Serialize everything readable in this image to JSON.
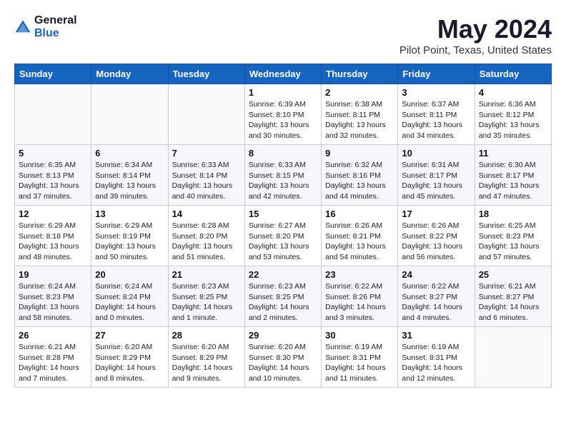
{
  "header": {
    "logo_general": "General",
    "logo_blue": "Blue",
    "month_title": "May 2024",
    "location": "Pilot Point, Texas, United States"
  },
  "days_of_week": [
    "Sunday",
    "Monday",
    "Tuesday",
    "Wednesday",
    "Thursday",
    "Friday",
    "Saturday"
  ],
  "weeks": [
    [
      {
        "day": "",
        "info": ""
      },
      {
        "day": "",
        "info": ""
      },
      {
        "day": "",
        "info": ""
      },
      {
        "day": "1",
        "info": "Sunrise: 6:39 AM\nSunset: 8:10 PM\nDaylight: 13 hours\nand 30 minutes."
      },
      {
        "day": "2",
        "info": "Sunrise: 6:38 AM\nSunset: 8:11 PM\nDaylight: 13 hours\nand 32 minutes."
      },
      {
        "day": "3",
        "info": "Sunrise: 6:37 AM\nSunset: 8:11 PM\nDaylight: 13 hours\nand 34 minutes."
      },
      {
        "day": "4",
        "info": "Sunrise: 6:36 AM\nSunset: 8:12 PM\nDaylight: 13 hours\nand 35 minutes."
      }
    ],
    [
      {
        "day": "5",
        "info": "Sunrise: 6:35 AM\nSunset: 8:13 PM\nDaylight: 13 hours\nand 37 minutes."
      },
      {
        "day": "6",
        "info": "Sunrise: 6:34 AM\nSunset: 8:14 PM\nDaylight: 13 hours\nand 39 minutes."
      },
      {
        "day": "7",
        "info": "Sunrise: 6:33 AM\nSunset: 8:14 PM\nDaylight: 13 hours\nand 40 minutes."
      },
      {
        "day": "8",
        "info": "Sunrise: 6:33 AM\nSunset: 8:15 PM\nDaylight: 13 hours\nand 42 minutes."
      },
      {
        "day": "9",
        "info": "Sunrise: 6:32 AM\nSunset: 8:16 PM\nDaylight: 13 hours\nand 44 minutes."
      },
      {
        "day": "10",
        "info": "Sunrise: 6:31 AM\nSunset: 8:17 PM\nDaylight: 13 hours\nand 45 minutes."
      },
      {
        "day": "11",
        "info": "Sunrise: 6:30 AM\nSunset: 8:17 PM\nDaylight: 13 hours\nand 47 minutes."
      }
    ],
    [
      {
        "day": "12",
        "info": "Sunrise: 6:29 AM\nSunset: 8:18 PM\nDaylight: 13 hours\nand 48 minutes."
      },
      {
        "day": "13",
        "info": "Sunrise: 6:29 AM\nSunset: 8:19 PM\nDaylight: 13 hours\nand 50 minutes."
      },
      {
        "day": "14",
        "info": "Sunrise: 6:28 AM\nSunset: 8:20 PM\nDaylight: 13 hours\nand 51 minutes."
      },
      {
        "day": "15",
        "info": "Sunrise: 6:27 AM\nSunset: 8:20 PM\nDaylight: 13 hours\nand 53 minutes."
      },
      {
        "day": "16",
        "info": "Sunrise: 6:26 AM\nSunset: 8:21 PM\nDaylight: 13 hours\nand 54 minutes."
      },
      {
        "day": "17",
        "info": "Sunrise: 6:26 AM\nSunset: 8:22 PM\nDaylight: 13 hours\nand 56 minutes."
      },
      {
        "day": "18",
        "info": "Sunrise: 6:25 AM\nSunset: 8:23 PM\nDaylight: 13 hours\nand 57 minutes."
      }
    ],
    [
      {
        "day": "19",
        "info": "Sunrise: 6:24 AM\nSunset: 8:23 PM\nDaylight: 13 hours\nand 58 minutes."
      },
      {
        "day": "20",
        "info": "Sunrise: 6:24 AM\nSunset: 8:24 PM\nDaylight: 14 hours\nand 0 minutes."
      },
      {
        "day": "21",
        "info": "Sunrise: 6:23 AM\nSunset: 8:25 PM\nDaylight: 14 hours\nand 1 minute."
      },
      {
        "day": "22",
        "info": "Sunrise: 6:23 AM\nSunset: 8:25 PM\nDaylight: 14 hours\nand 2 minutes."
      },
      {
        "day": "23",
        "info": "Sunrise: 6:22 AM\nSunset: 8:26 PM\nDaylight: 14 hours\nand 3 minutes."
      },
      {
        "day": "24",
        "info": "Sunrise: 6:22 AM\nSunset: 8:27 PM\nDaylight: 14 hours\nand 4 minutes."
      },
      {
        "day": "25",
        "info": "Sunrise: 6:21 AM\nSunset: 8:27 PM\nDaylight: 14 hours\nand 6 minutes."
      }
    ],
    [
      {
        "day": "26",
        "info": "Sunrise: 6:21 AM\nSunset: 8:28 PM\nDaylight: 14 hours\nand 7 minutes."
      },
      {
        "day": "27",
        "info": "Sunrise: 6:20 AM\nSunset: 8:29 PM\nDaylight: 14 hours\nand 8 minutes."
      },
      {
        "day": "28",
        "info": "Sunrise: 6:20 AM\nSunset: 8:29 PM\nDaylight: 14 hours\nand 9 minutes."
      },
      {
        "day": "29",
        "info": "Sunrise: 6:20 AM\nSunset: 8:30 PM\nDaylight: 14 hours\nand 10 minutes."
      },
      {
        "day": "30",
        "info": "Sunrise: 6:19 AM\nSunset: 8:31 PM\nDaylight: 14 hours\nand 11 minutes."
      },
      {
        "day": "31",
        "info": "Sunrise: 6:19 AM\nSunset: 8:31 PM\nDaylight: 14 hours\nand 12 minutes."
      },
      {
        "day": "",
        "info": ""
      }
    ]
  ]
}
